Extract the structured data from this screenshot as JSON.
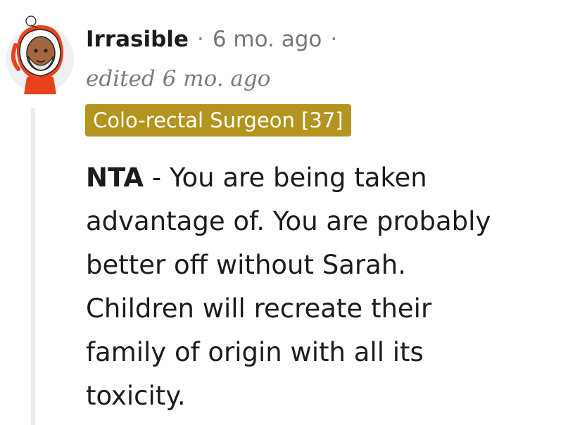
{
  "comment": {
    "author": "Irrasible",
    "separator": "·",
    "time": "6 mo. ago",
    "edited": "edited 6 mo. ago",
    "flair": "Colo-rectal Surgeon [37]",
    "body": {
      "verdict": "NTA",
      "line1_rest": " - You are being taken",
      "line2": "advantage of. You are probably",
      "line3": "better off without Sarah.",
      "line4": "Children will recreate their",
      "line5": "family of origin with all its",
      "line6": "toxicity."
    }
  },
  "colors": {
    "flair_bg": "#b3941f",
    "flair_text": "#ffffff",
    "thread_line": "#ebebeb",
    "avatar_hat": "#e8431c"
  },
  "icons": {
    "avatar": "snoo-avatar-orange-hoodie"
  }
}
